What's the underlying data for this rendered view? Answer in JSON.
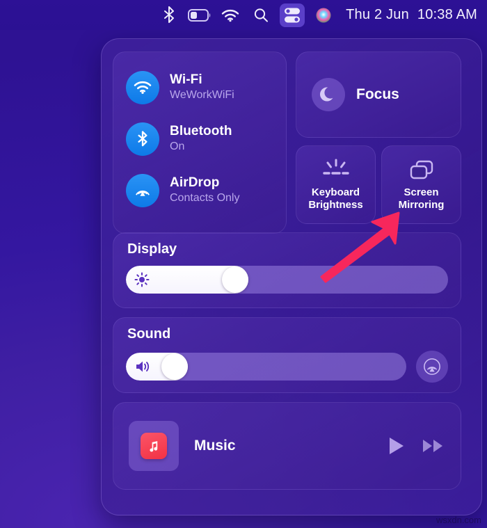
{
  "menubar": {
    "icons": [
      {
        "name": "bluetooth-icon",
        "label": "Bluetooth"
      },
      {
        "name": "battery-icon",
        "label": "Battery"
      },
      {
        "name": "wifi-icon",
        "label": "Wi-Fi"
      },
      {
        "name": "search-icon",
        "label": "Spotlight Search"
      },
      {
        "name": "control-center-icon",
        "label": "Control Center"
      },
      {
        "name": "siri-icon",
        "label": "Siri"
      }
    ],
    "date": "Thu 2 Jun",
    "time": "10:38 AM"
  },
  "control_center": {
    "connectivity": [
      {
        "icon": "wifi-icon",
        "title": "Wi-Fi",
        "subtitle": "WeWorkWiFi"
      },
      {
        "icon": "bluetooth-icon",
        "title": "Bluetooth",
        "subtitle": "On"
      },
      {
        "icon": "airdrop-icon",
        "title": "AirDrop",
        "subtitle": "Contacts Only"
      }
    ],
    "focus": {
      "icon": "moon-icon",
      "label": "Focus"
    },
    "tiles": [
      {
        "icon": "keyboard-brightness-icon",
        "label": "Keyboard\nBrightness",
        "line1": "Keyboard",
        "line2": "Brightness"
      },
      {
        "icon": "screen-mirroring-icon",
        "label": "Screen\nMirroring",
        "line1": "Screen",
        "line2": "Mirroring"
      }
    ],
    "display": {
      "title": "Display",
      "icon": "brightness-sun-icon",
      "value": 38
    },
    "sound": {
      "title": "Sound",
      "icon": "speaker-icon",
      "value": 22,
      "airplay_icon": "airplay-audio-icon"
    },
    "music": {
      "app_icon": "apple-music-icon",
      "name": "Music",
      "play_icon": "play-icon",
      "next_icon": "fast-forward-icon"
    }
  },
  "annotation": {
    "arrow_color": "#F7275C",
    "points_to": "Screen Mirroring"
  },
  "watermark": "wsxdn.com",
  "colors": {
    "accent_blue": "#1486f0",
    "panel_purple": "#4529a8",
    "background": "#3a1bb0",
    "music_red": "#f23244",
    "arrow_pink": "#F7275C"
  }
}
